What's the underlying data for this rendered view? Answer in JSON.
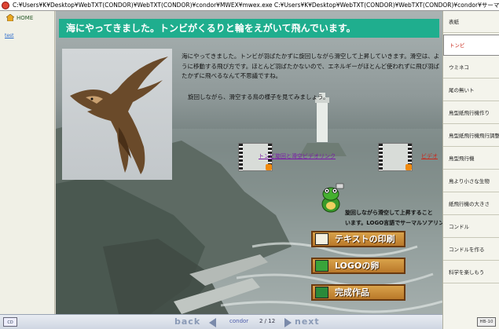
{
  "window": {
    "title": "C:¥Users¥K¥Desktop¥WebTXT(CONDOR)¥WebTXT(CONDOR)¥condor¥MWEX¥mwex.exe C:¥Users¥K¥Desktop¥WebTXT(CONDOR)¥WebTXT(CONDOR)¥condor¥サーマ..."
  },
  "left_nav": {
    "home_label": "HOME",
    "test_link": "test"
  },
  "main": {
    "heading": "海にやってきました。トンビがくるりと輪をえがいて飛んでいます。",
    "para1": "海にやってきました。トンビが羽ばたかずに旋回しながら滑空して上昇していきます。滑空は、ように移動する飛び方です。ほとんど羽ばたかないので、エネルギーがほとんど使われずに飛び羽ばたかずに飛べるなんて不思議ですね。",
    "para2": "旋回しながら、滑空する鳥の様子を見てみましょう。",
    "video_link1": "トンビ旋回と滑空ビデオリンク",
    "video_link2": "ビデオ",
    "tip_line1": "旋回しながら滑空して上昇すること",
    "tip_line2": "います。LOGO言語でサーマルソアリングす",
    "buttons": {
      "print": "テキストの印刷",
      "logo": "LOGOの卵",
      "complete": "完成作品"
    }
  },
  "bottom_bar": {
    "back_label": "back",
    "next_label": "next",
    "section": "condor",
    "page": "2 / 12"
  },
  "right_nav": {
    "items": [
      "表紙",
      "トンビ",
      "ウミネコ",
      "尾の無いト",
      "鳥型紙飛行機作り",
      "鳥型紙飛行機飛行調整",
      "鳥型飛行機",
      "鳥より小さな生物",
      "紙飛行機の大きさ",
      "コンドル",
      "コンドルを作る",
      "科学を楽しもう"
    ],
    "active_index": 1,
    "help_label": "HB-10"
  },
  "colors": {
    "heading_bg": "#1fae8e",
    "button_bg": "#c58a3a",
    "active_nav_text": "#c8281a"
  },
  "icons": [
    "app-icon",
    "home-icon",
    "video-icon",
    "frog-icon",
    "printer-icon",
    "logo-egg-icon",
    "trophy-icon"
  ]
}
